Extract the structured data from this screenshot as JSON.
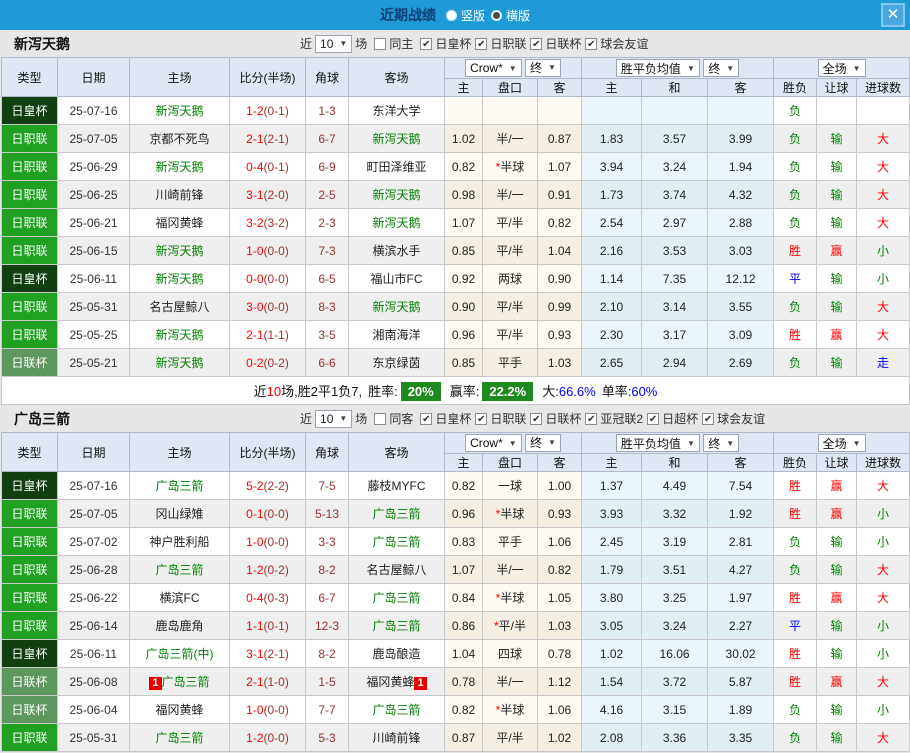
{
  "titlebar": {
    "title": "近期战绩",
    "vertical_label": "竖版",
    "horizontal_label": "横版",
    "close_label": "✕"
  },
  "filter": {
    "near": "近",
    "count": "10",
    "matches": "场"
  },
  "columns": {
    "type": "类型",
    "date": "日期",
    "home": "主场",
    "score": "比分(半场)",
    "corner": "角球",
    "away": "客场",
    "crow_select": "Crow*",
    "final_select": "终",
    "avg_select": "胜平负均值",
    "full_select": "全场",
    "odds_home": "主",
    "odds_line": "盘口",
    "odds_away": "客",
    "avg_home": "主",
    "avg_draw": "和",
    "avg_away": "客",
    "res_wdl": "胜负",
    "res_let": "让球",
    "res_goal": "进球数"
  },
  "result_color_classes": {
    "胜": "r-red",
    "平": "r-blue",
    "负": "r-green",
    "赢": "r-red",
    "输": "r-green",
    "走": "r-blue",
    "大": "r-red",
    "小": "r-green"
  },
  "colors": {
    "titlebar_blue": "#1e9ad6",
    "cup_dark_green": "#123f12",
    "league_green": "#21a121",
    "cup_light_green": "#5e975e",
    "team_green": "#008000",
    "score_red": "#ff0000",
    "summary_green_box": "#1e8a1e"
  },
  "sections": [
    {
      "team": "新泻天鹅",
      "same_label": "同主",
      "comp_filters": [
        "日皇杯",
        "日职联",
        "日联杯",
        "球会友谊"
      ],
      "rows": [
        {
          "type": "日皇杯",
          "tc": "dark",
          "date": "25-07-16",
          "home": "新泻天鹅",
          "home_team": true,
          "ft": "1-2",
          "ht": "(0-1)",
          "corner": "1-3",
          "away": "东洋大学",
          "away_team": false,
          "oh": "",
          "line": "",
          "oa": "",
          "ah": "",
          "ad": "",
          "aa": "",
          "rw": "负",
          "rl": "",
          "rg": ""
        },
        {
          "type": "日职联",
          "tc": "green",
          "date": "25-07-05",
          "home": "京都不死鸟",
          "home_team": false,
          "ft": "2-1",
          "ht": "(2-1)",
          "corner": "6-7",
          "away": "新泻天鹅",
          "away_team": true,
          "oh": "1.02",
          "line": "半/一",
          "oa": "0.87",
          "ah": "1.83",
          "ad": "3.57",
          "aa": "3.99",
          "rw": "负",
          "rl": "输",
          "rg": "大"
        },
        {
          "type": "日职联",
          "tc": "green",
          "date": "25-06-29",
          "home": "新泻天鹅",
          "home_team": true,
          "ft": "0-4",
          "ht": "(0-1)",
          "corner": "6-9",
          "away": "町田泽维亚",
          "away_team": false,
          "oh": "0.82",
          "line": "*半球",
          "oa": "1.07",
          "ah": "3.94",
          "ad": "3.24",
          "aa": "1.94",
          "rw": "负",
          "rl": "输",
          "rg": "大"
        },
        {
          "type": "日职联",
          "tc": "green",
          "date": "25-06-25",
          "home": "川崎前锋",
          "home_team": false,
          "ft": "3-1",
          "ht": "(2-0)",
          "corner": "2-5",
          "away": "新泻天鹅",
          "away_team": true,
          "oh": "0.98",
          "line": "半/一",
          "oa": "0.91",
          "ah": "1.73",
          "ad": "3.74",
          "aa": "4.32",
          "rw": "负",
          "rl": "输",
          "rg": "大"
        },
        {
          "type": "日职联",
          "tc": "green",
          "date": "25-06-21",
          "home": "福冈黄蜂",
          "home_team": false,
          "ft": "3-2",
          "ht": "(3-2)",
          "corner": "2-3",
          "away": "新泻天鹅",
          "away_team": true,
          "oh": "1.07",
          "line": "平/半",
          "oa": "0.82",
          "ah": "2.54",
          "ad": "2.97",
          "aa": "2.88",
          "rw": "负",
          "rl": "输",
          "rg": "大"
        },
        {
          "type": "日职联",
          "tc": "green",
          "date": "25-06-15",
          "home": "新泻天鹅",
          "home_team": true,
          "ft": "1-0",
          "ht": "(0-0)",
          "corner": "7-3",
          "away": "横滨水手",
          "away_team": false,
          "oh": "0.85",
          "line": "平/半",
          "oa": "1.04",
          "ah": "2.16",
          "ad": "3.53",
          "aa": "3.03",
          "rw": "胜",
          "rl": "赢",
          "rg": "小"
        },
        {
          "type": "日皇杯",
          "tc": "dark",
          "date": "25-06-11",
          "home": "新泻天鹅",
          "home_team": true,
          "ft": "0-0",
          "ht": "(0-0)",
          "corner": "6-5",
          "away": "福山市FC",
          "away_team": false,
          "oh": "0.92",
          "line": "两球",
          "oa": "0.90",
          "ah": "1.14",
          "ad": "7.35",
          "aa": "12.12",
          "rw": "平",
          "rl": "输",
          "rg": "小"
        },
        {
          "type": "日职联",
          "tc": "green",
          "date": "25-05-31",
          "home": "名古屋鲸八",
          "home_team": false,
          "ft": "3-0",
          "ht": "(0-0)",
          "corner": "8-3",
          "away": "新泻天鹅",
          "away_team": true,
          "oh": "0.90",
          "line": "平/半",
          "oa": "0.99",
          "ah": "2.10",
          "ad": "3.14",
          "aa": "3.55",
          "rw": "负",
          "rl": "输",
          "rg": "大"
        },
        {
          "type": "日职联",
          "tc": "green",
          "date": "25-05-25",
          "home": "新泻天鹅",
          "home_team": true,
          "ft": "2-1",
          "ht": "(1-1)",
          "corner": "3-5",
          "away": "湘南海洋",
          "away_team": false,
          "oh": "0.96",
          "line": "平/半",
          "oa": "0.93",
          "ah": "2.30",
          "ad": "3.17",
          "aa": "3.09",
          "rw": "胜",
          "rl": "赢",
          "rg": "大"
        },
        {
          "type": "日联杯",
          "tc": "sage",
          "date": "25-05-21",
          "home": "新泻天鹅",
          "home_team": true,
          "ft": "0-2",
          "ht": "(0-2)",
          "corner": "6-6",
          "away": "东京绿茵",
          "away_team": false,
          "oh": "0.85",
          "line": "平手",
          "oa": "1.03",
          "ah": "2.65",
          "ad": "2.94",
          "aa": "2.69",
          "rw": "负",
          "rl": "输",
          "rg": "走"
        }
      ],
      "summary": {
        "prefix": "近",
        "count": "10",
        "mid": "场,胜2平1负7,",
        "win_label": "胜率:",
        "win": "20%",
        "profit_label": "赢率:",
        "profit": "22.2%",
        "big_label": "大:",
        "big": "66.6%",
        "single_label": "单率:",
        "single": "60%"
      }
    },
    {
      "team": "广岛三箭",
      "same_label": "同客",
      "comp_filters": [
        "日皇杯",
        "日职联",
        "日联杯",
        "亚冠联2",
        "日超杯",
        "球会友谊"
      ],
      "rows": [
        {
          "type": "日皇杯",
          "tc": "dark",
          "date": "25-07-16",
          "home": "广岛三箭",
          "home_team": true,
          "ft": "5-2",
          "ht": "(2-2)",
          "corner": "7-5",
          "away": "藤枝MYFC",
          "away_team": false,
          "oh": "0.82",
          "line": "一球",
          "oa": "1.00",
          "ah": "1.37",
          "ad": "4.49",
          "aa": "7.54",
          "rw": "胜",
          "rl": "赢",
          "rg": "大"
        },
        {
          "type": "日职联",
          "tc": "green",
          "date": "25-07-05",
          "home": "冈山绿雉",
          "home_team": false,
          "ft": "0-1",
          "ht": "(0-0)",
          "corner": "5-13",
          "away": "广岛三箭",
          "away_team": true,
          "oh": "0.96",
          "line": "*半球",
          "oa": "0.93",
          "ah": "3.93",
          "ad": "3.32",
          "aa": "1.92",
          "rw": "胜",
          "rl": "赢",
          "rg": "小"
        },
        {
          "type": "日职联",
          "tc": "green",
          "date": "25-07-02",
          "home": "神户胜利船",
          "home_team": false,
          "ft": "1-0",
          "ht": "(0-0)",
          "corner": "3-3",
          "away": "广岛三箭",
          "away_team": true,
          "oh": "0.83",
          "line": "平手",
          "oa": "1.06",
          "ah": "2.45",
          "ad": "3.19",
          "aa": "2.81",
          "rw": "负",
          "rl": "输",
          "rg": "小"
        },
        {
          "type": "日职联",
          "tc": "green",
          "date": "25-06-28",
          "home": "广岛三箭",
          "home_team": true,
          "ft": "1-2",
          "ht": "(0-2)",
          "corner": "8-2",
          "away": "名古屋鲸八",
          "away_team": false,
          "oh": "1.07",
          "line": "半/一",
          "oa": "0.82",
          "ah": "1.79",
          "ad": "3.51",
          "aa": "4.27",
          "rw": "负",
          "rl": "输",
          "rg": "大"
        },
        {
          "type": "日职联",
          "tc": "green",
          "date": "25-06-22",
          "home": "横滨FC",
          "home_team": false,
          "ft": "0-4",
          "ht": "(0-3)",
          "corner": "6-7",
          "away": "广岛三箭",
          "away_team": true,
          "oh": "0.84",
          "line": "*半球",
          "oa": "1.05",
          "ah": "3.80",
          "ad": "3.25",
          "aa": "1.97",
          "rw": "胜",
          "rl": "赢",
          "rg": "大"
        },
        {
          "type": "日职联",
          "tc": "green",
          "date": "25-06-14",
          "home": "鹿岛鹿角",
          "home_team": false,
          "ft": "1-1",
          "ht": "(0-1)",
          "corner": "12-3",
          "away": "广岛三箭",
          "away_team": true,
          "oh": "0.86",
          "line": "*平/半",
          "oa": "1.03",
          "ah": "3.05",
          "ad": "3.24",
          "aa": "2.27",
          "rw": "平",
          "rl": "输",
          "rg": "小"
        },
        {
          "type": "日皇杯",
          "tc": "dark",
          "date": "25-06-11",
          "home": "广岛三箭(中)",
          "home_team": true,
          "ft": "3-1",
          "ht": "(2-1)",
          "corner": "8-2",
          "away": "鹿岛酿造",
          "away_team": false,
          "oh": "1.04",
          "line": "四球",
          "oa": "0.78",
          "ah": "1.02",
          "ad": "16.06",
          "aa": "30.02",
          "rw": "胜",
          "rl": "输",
          "rg": "小"
        },
        {
          "type": "日联杯",
          "tc": "sage",
          "date": "25-06-08",
          "home": "广岛三箭",
          "home_team": true,
          "home_badge": "1",
          "ft": "2-1",
          "ht": "(1-0)",
          "corner": "1-5",
          "away": "福冈黄蜂",
          "away_team": false,
          "away_badge": "1",
          "oh": "0.78",
          "line": "半/一",
          "oa": "1.12",
          "ah": "1.54",
          "ad": "3.72",
          "aa": "5.87",
          "rw": "胜",
          "rl": "赢",
          "rg": "大"
        },
        {
          "type": "日联杯",
          "tc": "sage",
          "date": "25-06-04",
          "home": "福冈黄蜂",
          "home_team": false,
          "ft": "1-0",
          "ht": "(0-0)",
          "corner": "7-7",
          "away": "广岛三箭",
          "away_team": true,
          "oh": "0.82",
          "line": "*半球",
          "oa": "1.06",
          "ah": "4.16",
          "ad": "3.15",
          "aa": "1.89",
          "rw": "负",
          "rl": "输",
          "rg": "小"
        },
        {
          "type": "日职联",
          "tc": "green",
          "date": "25-05-31",
          "home": "广岛三箭",
          "home_team": true,
          "ft": "1-2",
          "ht": "(0-0)",
          "corner": "5-3",
          "away": "川崎前锋",
          "away_team": false,
          "oh": "0.87",
          "line": "平/半",
          "oa": "1.02",
          "ah": "2.08",
          "ad": "3.36",
          "aa": "3.35",
          "rw": "负",
          "rl": "输",
          "rg": "大"
        }
      ]
    }
  ]
}
